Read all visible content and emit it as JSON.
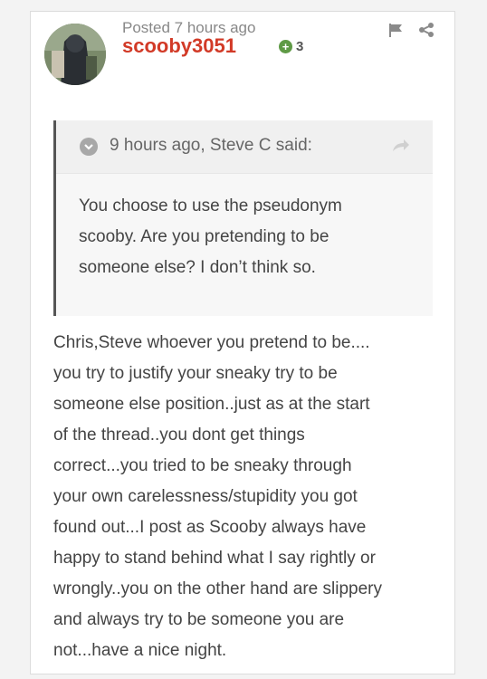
{
  "post": {
    "posted": "Posted 7 hours ago",
    "username": "scooby3051",
    "reputation": "3",
    "icons": [
      "flag-icon",
      "share-icon"
    ],
    "username_color": "#d23a27"
  },
  "quote": {
    "citation": "9 hours ago, Steve C said:",
    "lines": [
      "You choose to use the pseudonym",
      "scooby. Are you pretending to be",
      "someone else? I don’t think so."
    ]
  },
  "body": {
    "lines": [
      "Chris,Steve whoever you pretend to be....",
      "you try to justify your sneaky try to be",
      "someone else position..just as at the start",
      "of the thread..you dont get things",
      "correct...you tried to be sneaky through",
      "your own carelessness/stupidity you got",
      "found out...I post as Scooby always have",
      "happy to stand behind what I say rightly or",
      "wrongly..you on the other hand are slippery",
      "and always try to be someone you are",
      "not...have a nice night."
    ]
  }
}
